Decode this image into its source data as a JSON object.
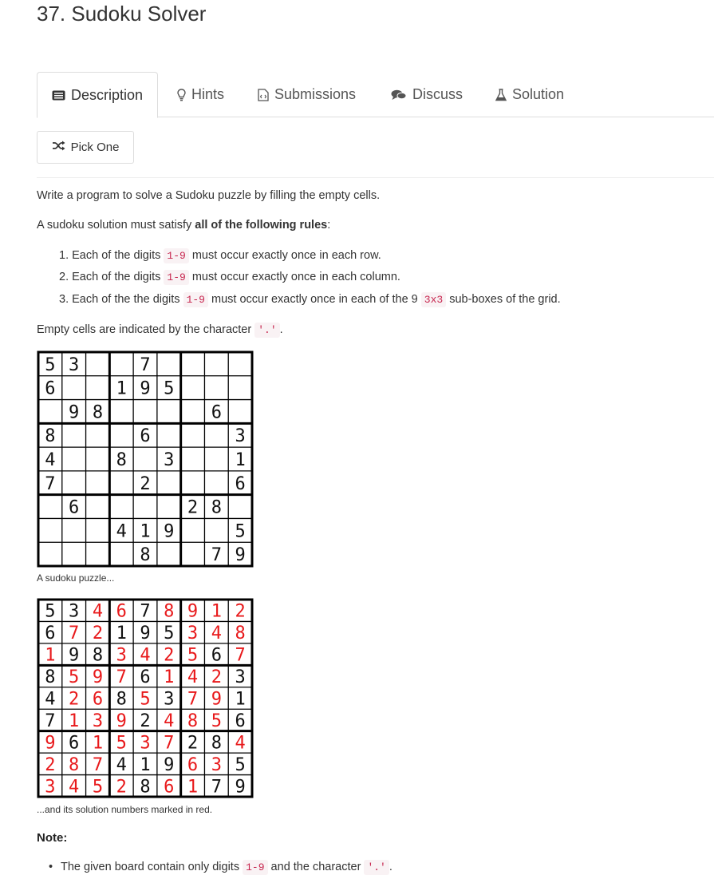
{
  "problem": {
    "title": "37. Sudoku Solver"
  },
  "tabs": [
    {
      "label": "Description",
      "icon": "description-icon",
      "active": true
    },
    {
      "label": "Hints",
      "icon": "lightbulb-icon",
      "active": false
    },
    {
      "label": "Submissions",
      "icon": "code-file-icon",
      "active": false
    },
    {
      "label": "Discuss",
      "icon": "comments-icon",
      "active": false
    },
    {
      "label": "Solution",
      "icon": "flask-icon",
      "active": false
    }
  ],
  "pick_one": {
    "label": "Pick One",
    "icon": "random-icon"
  },
  "description": {
    "intro": "Write a program to solve a Sudoku puzzle by filling the empty cells.",
    "rules_lead": "A sudoku solution must satisfy ",
    "rules_bold": "all of the following rules",
    "rules_tail": ":",
    "rules": [
      {
        "num": "1. ",
        "pre": "Each of the digits ",
        "code": "1-9",
        "post": " must occur exactly once in each row."
      },
      {
        "num": "2. ",
        "pre": "Each of the digits ",
        "code": "1-9",
        "post": " must occur exactly once in each column."
      },
      {
        "num": "3. ",
        "pre": "Each of the the digits ",
        "code": "1-9",
        "post": " must occur exactly once in each of the 9 ",
        "code2": "3x3",
        "post2": " sub-boxes of the grid."
      }
    ],
    "empty_pre": "Empty cells are indicated by the character ",
    "empty_code": "'.'",
    "empty_post": ".",
    "caption_puzzle": "A sudoku puzzle...",
    "caption_solution": "...and its solution numbers marked in red.",
    "note_title": "Note:",
    "note_bullet_pre": "The given board contain only digits ",
    "note_bullet_code": "1-9",
    "note_bullet_mid": " and the character ",
    "note_bullet_code2": "'.'",
    "note_bullet_post": "."
  },
  "puzzle": [
    "53..7....",
    "6..195...",
    ".98....6.",
    "8...6...3",
    "4..8.3..1",
    "7...2...6",
    ".6....28.",
    "...419..5",
    "....8..79"
  ],
  "solution": [
    "534678912",
    "672195348",
    "198342567",
    "859761423",
    "426853791",
    "713924856",
    "961537284",
    "287419635",
    "345286179"
  ],
  "colors": {
    "given": "#111111",
    "solved": "#e8191b",
    "code_text": "#c7254e",
    "code_bg": "#f9f2f4"
  }
}
